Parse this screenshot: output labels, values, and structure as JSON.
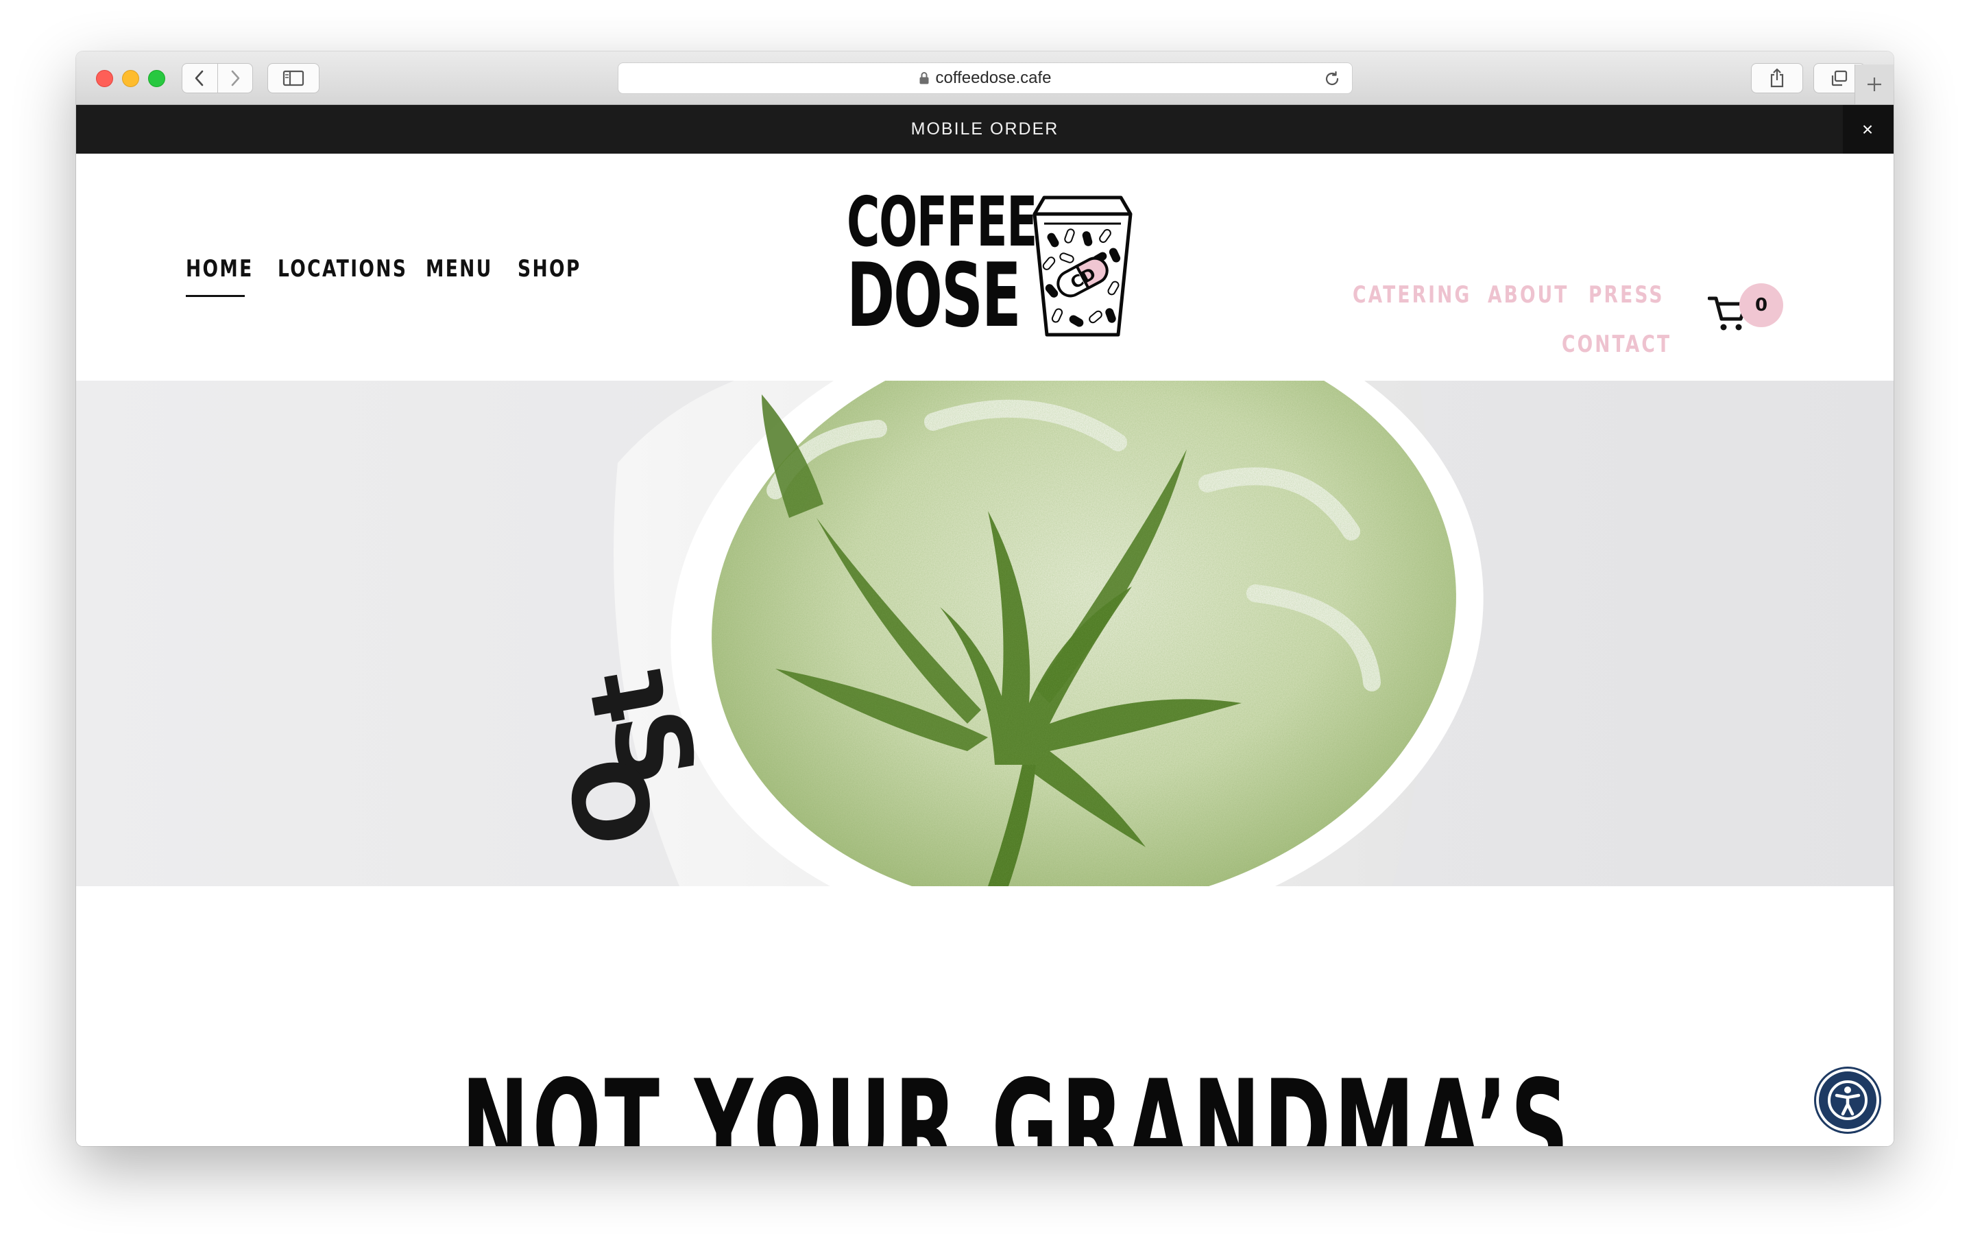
{
  "browser": {
    "url": "coffeedose.cafe"
  },
  "announcement": {
    "text": "MOBILE ORDER",
    "close_label": "×"
  },
  "nav_left": [
    {
      "label": "HOME",
      "active": true
    },
    {
      "label": "LOCATIONS",
      "active": false
    },
    {
      "label": "MENU",
      "active": false
    },
    {
      "label": "SHOP",
      "active": false
    }
  ],
  "logo": {
    "line1": "COFFEE",
    "line2": "DOSE",
    "cup_initials": "CD"
  },
  "nav_right": [
    {
      "label": "CATERING"
    },
    {
      "label": "ABOUT"
    },
    {
      "label": "PRESS"
    },
    {
      "label": "CONTACT"
    }
  ],
  "cart": {
    "count": "0",
    "icon": "cart-icon"
  },
  "hero": {
    "image": "matcha-latte-cannabis-leaf-art"
  },
  "content": {
    "headline": "NOT YOUR GRANDMA’S"
  },
  "accessibility": {
    "icon": "accessibility-icon"
  },
  "colors": {
    "announcement_bg": "#1b1b1b",
    "nav_right": "#eec2cf",
    "cart_badge": "#f0c6d2",
    "accessibility_button": "#1e3a63"
  }
}
